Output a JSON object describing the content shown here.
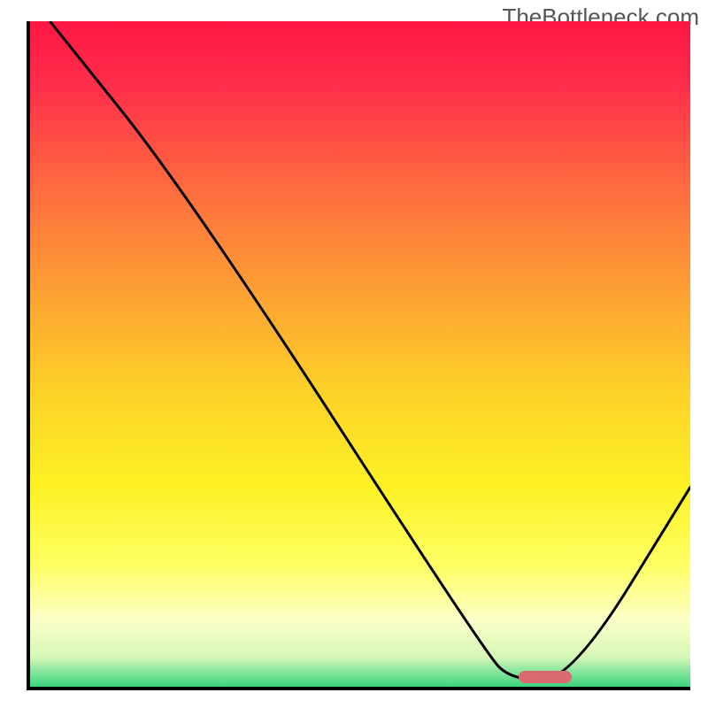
{
  "watermark": "TheBottleneck.com",
  "chart_data": {
    "type": "line",
    "title": "",
    "xlabel": "",
    "ylabel": "",
    "xlim": [
      0,
      100
    ],
    "ylim": [
      0,
      100
    ],
    "grid": false,
    "background": {
      "type": "vertical-gradient",
      "stops": [
        {
          "pos": 0.0,
          "color": "#ff1744"
        },
        {
          "pos": 0.1,
          "color": "#ff2f4a"
        },
        {
          "pos": 0.25,
          "color": "#fe6b3f"
        },
        {
          "pos": 0.4,
          "color": "#fd9e34"
        },
        {
          "pos": 0.55,
          "color": "#fdd028"
        },
        {
          "pos": 0.7,
          "color": "#fdf224"
        },
        {
          "pos": 0.82,
          "color": "#feff66"
        },
        {
          "pos": 0.9,
          "color": "#fdffc8"
        },
        {
          "pos": 0.955,
          "color": "#d6f8b8"
        },
        {
          "pos": 0.975,
          "color": "#8fe79e"
        },
        {
          "pos": 1.0,
          "color": "#3bd47f"
        }
      ]
    },
    "curve": {
      "color": "#000000",
      "width": 3,
      "points": [
        {
          "x": 3,
          "y": 100
        },
        {
          "x": 24,
          "y": 74
        },
        {
          "x": 69,
          "y": 5
        },
        {
          "x": 73,
          "y": 1
        },
        {
          "x": 82,
          "y": 1
        },
        {
          "x": 100,
          "y": 30
        }
      ],
      "note": "V-shaped curve descending from top-left to a flat minimum near x≈73–82 then rising toward right edge"
    },
    "optimal_marker": {
      "x_start": 74,
      "x_end": 82,
      "y": 1.5,
      "color": "#d96a6f"
    }
  }
}
